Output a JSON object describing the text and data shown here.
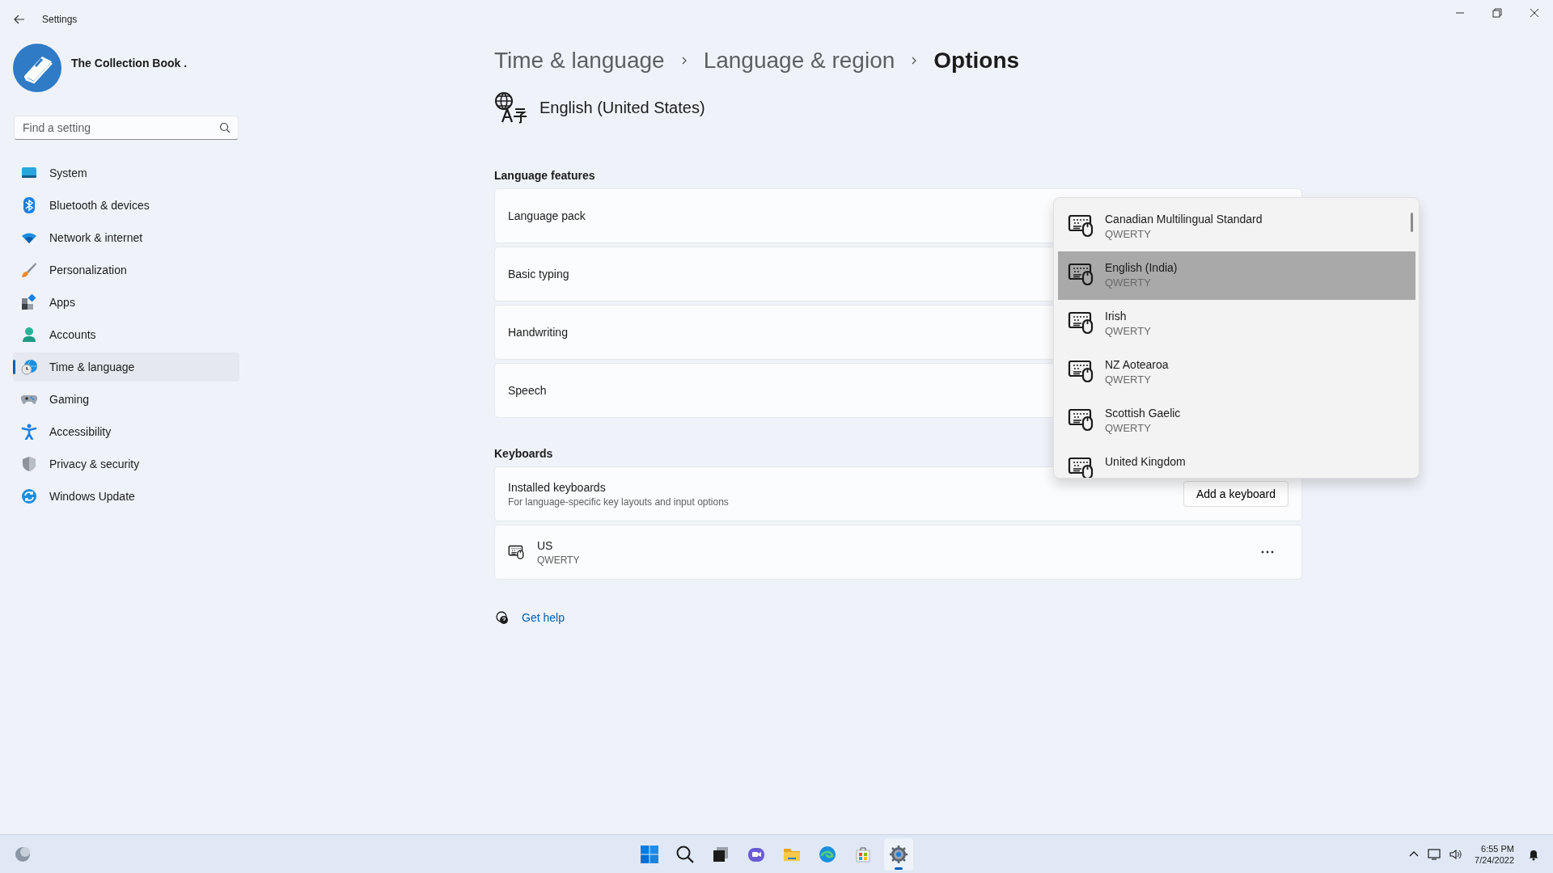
{
  "window": {
    "title": "Settings"
  },
  "account": {
    "name": "The Collection Book ."
  },
  "search": {
    "placeholder": "Find a setting"
  },
  "nav": [
    {
      "label": "System",
      "selected": false
    },
    {
      "label": "Bluetooth & devices",
      "selected": false
    },
    {
      "label": "Network & internet",
      "selected": false
    },
    {
      "label": "Personalization",
      "selected": false
    },
    {
      "label": "Apps",
      "selected": false
    },
    {
      "label": "Accounts",
      "selected": false
    },
    {
      "label": "Time & language",
      "selected": true
    },
    {
      "label": "Gaming",
      "selected": false
    },
    {
      "label": "Accessibility",
      "selected": false
    },
    {
      "label": "Privacy & security",
      "selected": false
    },
    {
      "label": "Windows Update",
      "selected": false
    }
  ],
  "breadcrumb": [
    {
      "label": "Time & language",
      "current": false
    },
    {
      "label": "Language & region",
      "current": false
    },
    {
      "label": "Options",
      "current": true
    }
  ],
  "language": {
    "name": "English (United States)"
  },
  "features": {
    "heading": "Language features",
    "rows": [
      "Language pack",
      "Basic typing",
      "Handwriting",
      "Speech"
    ]
  },
  "keyboards": {
    "heading": "Keyboards",
    "installed": {
      "title": "Installed keyboards",
      "subtitle": "For language-specific key layouts and input options",
      "button": "Add a keyboard"
    },
    "list": [
      {
        "name": "US",
        "layout": "QWERTY"
      }
    ]
  },
  "help": {
    "label": "Get help"
  },
  "dropdown": {
    "items": [
      {
        "name": "Canadian Multilingual Standard",
        "layout": "QWERTY",
        "selected": false
      },
      {
        "name": "English (India)",
        "layout": "QWERTY",
        "selected": true
      },
      {
        "name": "Irish",
        "layout": "QWERTY",
        "selected": false
      },
      {
        "name": "NZ Aotearoa",
        "layout": "QWERTY",
        "selected": false
      },
      {
        "name": "Scottish Gaelic",
        "layout": "QWERTY",
        "selected": false
      },
      {
        "name": "United Kingdom",
        "selected": false
      }
    ]
  },
  "taskbar": {
    "apps": [
      {
        "active": false
      },
      {
        "active": false
      },
      {
        "active": false
      },
      {
        "active": false
      },
      {
        "active": false
      },
      {
        "active": false
      },
      {
        "active": false
      },
      {
        "active": true
      }
    ],
    "time": "6:55 PM",
    "date": "7/24/2022"
  }
}
